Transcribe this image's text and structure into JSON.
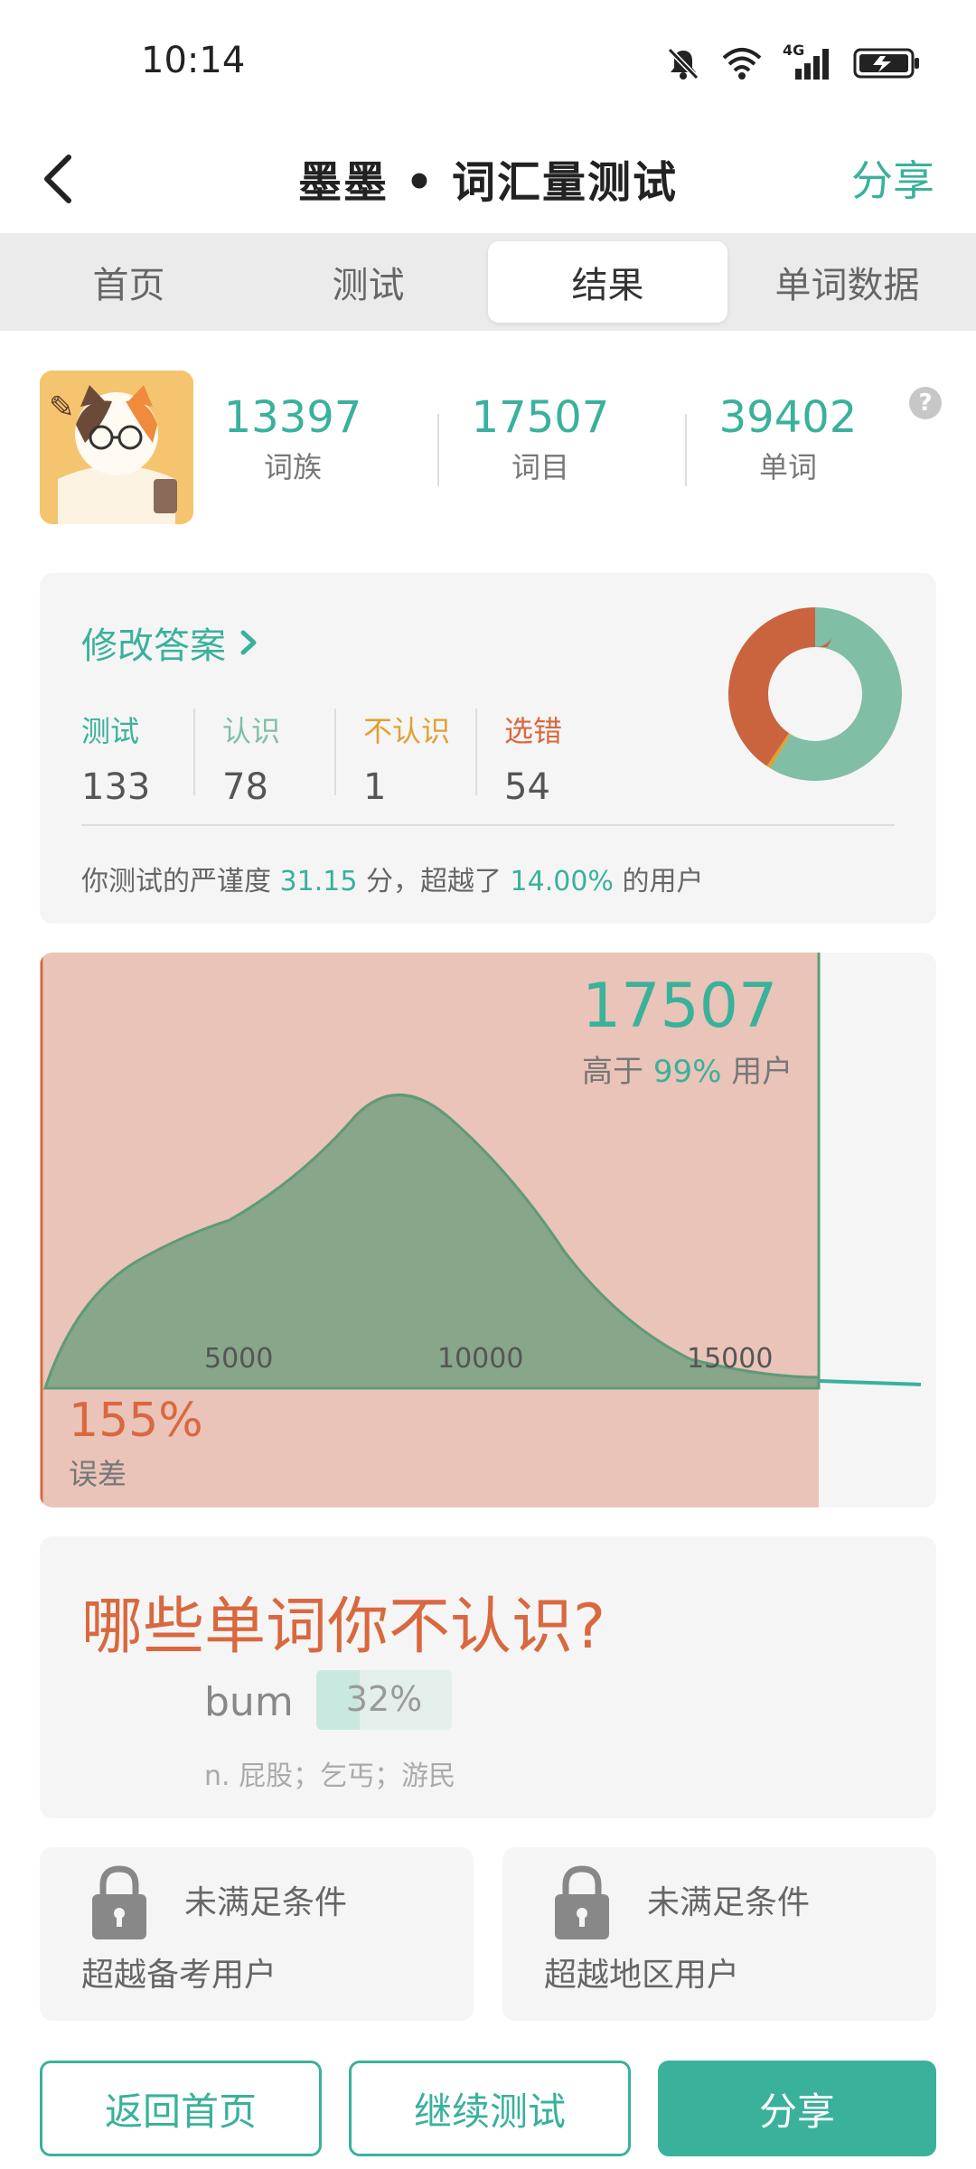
{
  "status_bar": {
    "time": "10:14",
    "network": "4G"
  },
  "header": {
    "title": "墨墨 • 词汇量测试",
    "share_label": "分享"
  },
  "tabs": [
    {
      "label": "首页"
    },
    {
      "label": "测试"
    },
    {
      "label": "结果",
      "active": true
    },
    {
      "label": "单词数据"
    }
  ],
  "stats": [
    {
      "value": "13397",
      "label": "词族"
    },
    {
      "value": "17507",
      "label": "词目"
    },
    {
      "value": "39402",
      "label": "单词"
    }
  ],
  "help_label": "?",
  "answer_card": {
    "edit_label": "修改答案",
    "metrics": [
      {
        "label": "测试",
        "value": "133",
        "color": "#3ab19b"
      },
      {
        "label": "认识",
        "value": "78",
        "color": "#7fbfa5"
      },
      {
        "label": "不认识",
        "value": "1",
        "color": "#e0a130"
      },
      {
        "label": "选错",
        "value": "54",
        "color": "#d9683f"
      }
    ],
    "rigor": {
      "prefix": "你测试的严谨度 ",
      "score": "31.15",
      "mid": " 分，超越了 ",
      "percent": "14.00%",
      "suffix": " 的用户"
    }
  },
  "chart_data": {
    "type": "area",
    "title": "",
    "xlabel": "",
    "ylabel": "",
    "x_ticks": [
      "5000",
      "10000",
      "15000"
    ],
    "xlim": [
      0,
      20000
    ],
    "result_value": "17507",
    "higher_prefix": "高于 ",
    "higher_percent": "99%",
    "higher_suffix": " 用户",
    "error_value": "155%",
    "error_label": "误差",
    "donut": {
      "slices": [
        {
          "label": "认识",
          "value": 78,
          "color": "#80bea5"
        },
        {
          "label": "不认识",
          "value": 1,
          "color": "#e0a130"
        },
        {
          "label": "选错",
          "value": 54,
          "color": "#c9643f"
        }
      ]
    }
  },
  "unknown_words": {
    "title": "哪些单词你不认识?",
    "word": "bum",
    "percent_label": "32%",
    "percent_value": 0.32,
    "definition": "n. 屁股；乞丐；游民"
  },
  "achievements": [
    {
      "status": "未满足条件",
      "description": "超越备考用户"
    },
    {
      "status": "未满足条件",
      "description": "超越地区用户"
    }
  ],
  "buttons": {
    "home": "返回首页",
    "continue": "继续测试",
    "share": "分享"
  },
  "colors": {
    "accent": "#3ab19b",
    "error": "#d9683f",
    "range_fill": "#eac4b8",
    "curve_fill": "#88a68a"
  }
}
